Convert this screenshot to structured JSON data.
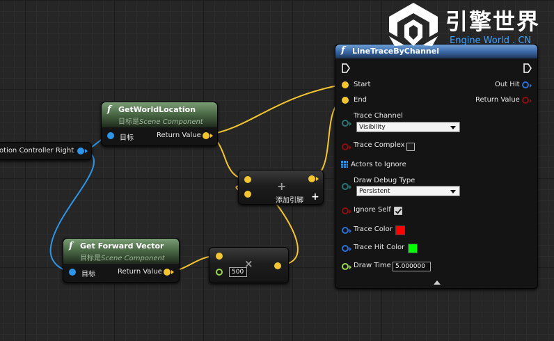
{
  "watermark": {
    "title_cn": "引擎世界",
    "title_en": "Engine World . CN"
  },
  "left_node": {
    "label": "otion Controller Right"
  },
  "get_world_location": {
    "title": "GetWorldLocation",
    "subtitle_prefix": "目标是",
    "subtitle_target": "Scene Component",
    "input_label": "目标",
    "output_label": "Return Value"
  },
  "get_forward_vector": {
    "title": "Get Forward Vector",
    "subtitle_prefix": "目标是",
    "subtitle_target": "Scene Component",
    "input_label": "目标",
    "output_label": "Return Value"
  },
  "add_node": {
    "symbol": "+",
    "add_pin_label": "添加引脚",
    "add_pin_icon": "+"
  },
  "multiply_node": {
    "symbol": "×",
    "value": "500"
  },
  "line_trace": {
    "title": "LineTraceByChannel",
    "start_label": "Start",
    "end_label": "End",
    "out_hit_label": "Out Hit",
    "return_value_label": "Return Value",
    "trace_channel_label": "Trace Channel",
    "trace_channel_value": "Visibility",
    "trace_complex_label": "Trace Complex",
    "trace_complex_checked": false,
    "actors_to_ignore_label": "Actors to Ignore",
    "draw_debug_type_label": "Draw Debug Type",
    "draw_debug_type_value": "Persistent",
    "ignore_self_label": "Ignore Self",
    "ignore_self_checked": true,
    "trace_color_label": "Trace Color",
    "trace_color": "#ff0000",
    "trace_hit_color_label": "Trace Hit Color",
    "trace_hit_color": "#00ff00",
    "draw_time_label": "Draw Time",
    "draw_time_value": "5.000000",
    "expand_icon": "chevron-up-icon"
  },
  "colors": {
    "object_pin": "#2d96e8",
    "vector_pin": "#f5c531",
    "struct_pin": "#2d6fd6",
    "bool_pin": "#8c0f0f",
    "float_pin": "#9ad84f",
    "enum_pin": "#1f5d5d"
  }
}
